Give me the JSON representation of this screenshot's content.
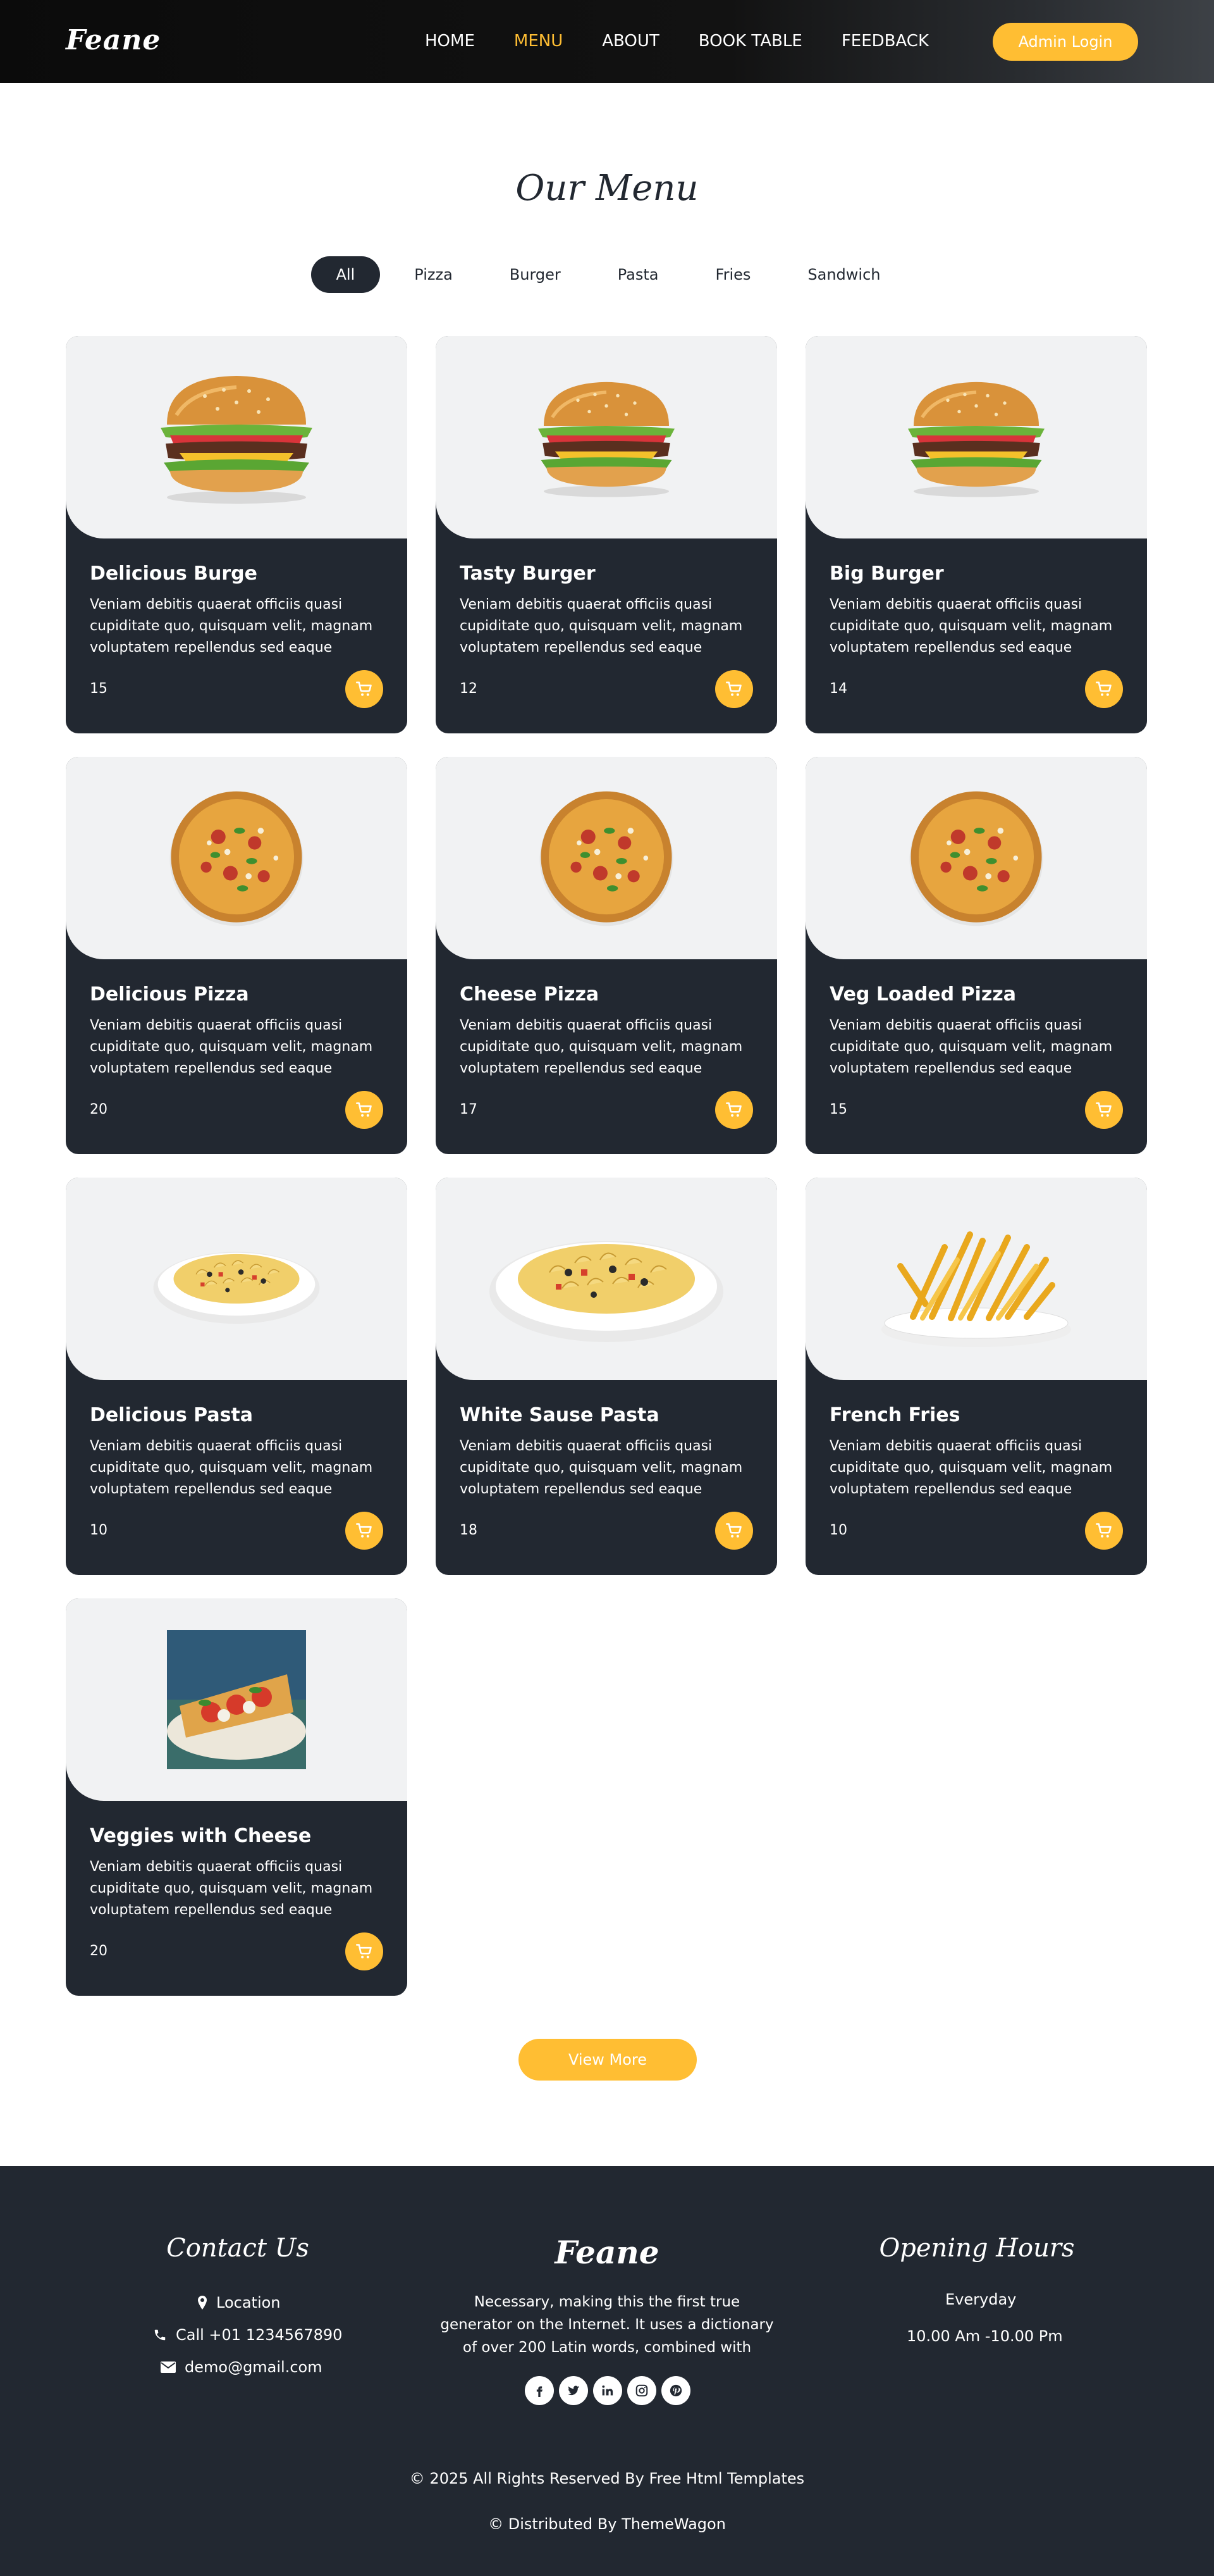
{
  "header": {
    "brand": "Feane",
    "nav": [
      "HOME",
      "MENU",
      "ABOUT",
      "BOOK TABLE",
      "FEEDBACK"
    ],
    "active_nav": "MENU",
    "admin_label": "Admin Login"
  },
  "menu": {
    "title": "Our Menu",
    "filters": [
      "All",
      "Pizza",
      "Burger",
      "Pasta",
      "Fries",
      "Sandwich"
    ],
    "active_filter": "All",
    "items": [
      {
        "name": "Delicious Burge",
        "desc": "Veniam debitis quaerat officiis quasi cupiditate quo, quisquam velit, magnam voluptatem repellendus sed eaque",
        "price": "15",
        "icon": "burger-image"
      },
      {
        "name": "Tasty Burger",
        "desc": "Veniam debitis quaerat officiis quasi cupiditate quo, quisquam velit, magnam voluptatem repellendus sed eaque",
        "price": "12",
        "icon": "burger-image"
      },
      {
        "name": "Big Burger",
        "desc": "Veniam debitis quaerat officiis quasi cupiditate quo, quisquam velit, magnam voluptatem repellendus sed eaque",
        "price": "14",
        "icon": "burger-image"
      },
      {
        "name": "Delicious Pizza",
        "desc": "Veniam debitis quaerat officiis quasi cupiditate quo, quisquam velit, magnam voluptatem repellendus sed eaque",
        "price": "20",
        "icon": "pizza-image"
      },
      {
        "name": "Cheese Pizza",
        "desc": "Veniam debitis quaerat officiis quasi cupiditate quo, quisquam velit, magnam voluptatem repellendus sed eaque",
        "price": "17",
        "icon": "pizza-image"
      },
      {
        "name": "Veg Loaded Pizza",
        "desc": "Veniam debitis quaerat officiis quasi cupiditate quo, quisquam velit, magnam voluptatem repellendus sed eaque",
        "price": "15",
        "icon": "pizza-image"
      },
      {
        "name": "Delicious Pasta",
        "desc": "Veniam debitis quaerat officiis quasi cupiditate quo, quisquam velit, magnam voluptatem repellendus sed eaque",
        "price": "10",
        "icon": "pasta-image"
      },
      {
        "name": "White Sause Pasta",
        "desc": "Veniam debitis quaerat officiis quasi cupiditate quo, quisquam velit, magnam voluptatem repellendus sed eaque",
        "price": "18",
        "icon": "pasta-image"
      },
      {
        "name": "French Fries",
        "desc": "Veniam debitis quaerat officiis quasi cupiditate quo, quisquam velit, magnam voluptatem repellendus sed eaque",
        "price": "10",
        "icon": "fries-image"
      },
      {
        "name": "Veggies with Cheese",
        "desc": "Veniam debitis quaerat officiis quasi cupiditate quo, quisquam velit, magnam voluptatem repellendus sed eaque",
        "price": "20",
        "icon": "sandwich-image"
      }
    ],
    "view_more": "View More"
  },
  "footer": {
    "contact": {
      "title": "Contact Us",
      "location": "Location",
      "phone": "Call +01 1234567890",
      "email": "demo@gmail.com"
    },
    "about": {
      "brand": "Feane",
      "text": "Necessary, making this the first true generator on the Internet. It uses a dictionary of over 200 Latin words, combined with",
      "socials": [
        "facebook-icon",
        "twitter-icon",
        "linkedin-icon",
        "instagram-icon",
        "pinterest-icon"
      ]
    },
    "hours": {
      "title": "Opening Hours",
      "days": "Everyday",
      "time": "10.00 Am -10.00 Pm"
    },
    "copyright": "© 2025 All Rights Reserved By Free Html Templates",
    "distributed": "© Distributed By ThemeWagon"
  },
  "colors": {
    "accent": "#ffbe33",
    "dark": "#222831",
    "card_bg": "#f1f2f3"
  }
}
